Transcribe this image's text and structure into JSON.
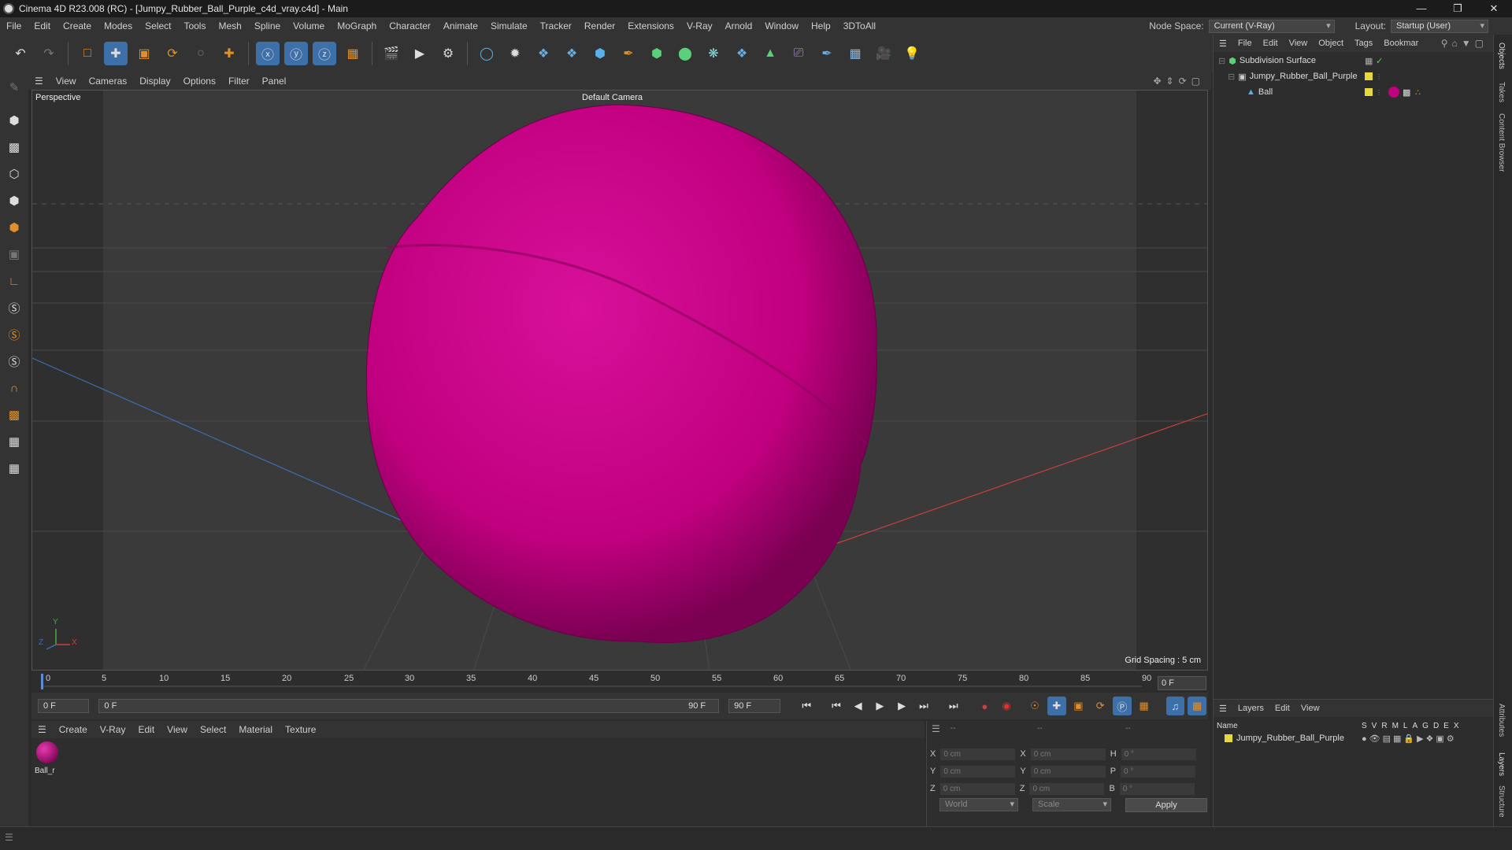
{
  "window": {
    "title": "Cinema 4D R23.008 (RC) - [Jumpy_Rubber_Ball_Purple_c4d_vray.c4d] - Main",
    "minimize": "—",
    "maximize": "❐",
    "close": "✕"
  },
  "menubar": {
    "items": [
      "File",
      "Edit",
      "Create",
      "Modes",
      "Select",
      "Tools",
      "Mesh",
      "Spline",
      "Volume",
      "MoGraph",
      "Character",
      "Animate",
      "Simulate",
      "Tracker",
      "Render",
      "Extensions",
      "V-Ray",
      "Arnold",
      "Window",
      "Help",
      "3DToAll"
    ],
    "node_space_label": "Node Space:",
    "node_space_value": "Current (V-Ray)",
    "layout_label": "Layout:",
    "layout_value": "Startup (User)"
  },
  "viewport": {
    "menu": [
      "View",
      "Cameras",
      "Display",
      "Options",
      "Filter",
      "Panel"
    ],
    "view_label": "Perspective",
    "camera_label": "Default Camera",
    "grid_spacing": "Grid Spacing : 5 cm",
    "axis_y": "Y",
    "axis_z": "Z",
    "axis_x": "X"
  },
  "colors": {
    "ball": "#c8008a",
    "accent": "#3d6fa8",
    "axis_red": "#c84040",
    "axis_blue": "#3c6fb0",
    "axis_green": "#4ca64c"
  },
  "timeline": {
    "ticks": [
      "0",
      "5",
      "10",
      "15",
      "20",
      "25",
      "30",
      "35",
      "40",
      "45",
      "50",
      "55",
      "60",
      "65",
      "70",
      "75",
      "80",
      "85",
      "90"
    ],
    "current_frame_field": "0 F",
    "start": "0 F",
    "range_start": "0 F",
    "range_end": "90 F",
    "end": "90 F"
  },
  "material_manager": {
    "menu": [
      "Create",
      "V-Ray",
      "Edit",
      "View",
      "Select",
      "Material",
      "Texture"
    ],
    "material_name": "Ball_r"
  },
  "coordinates": {
    "header_left": "--",
    "header_mid": "--",
    "header_right": "--",
    "rows": [
      {
        "a": "X",
        "av": "0 cm",
        "b": "X",
        "bv": "0 cm",
        "c": "H",
        "cv": "0 °"
      },
      {
        "a": "Y",
        "av": "0 cm",
        "b": "Y",
        "bv": "0 cm",
        "c": "P",
        "cv": "0 °"
      },
      {
        "a": "Z",
        "av": "0 cm",
        "b": "Z",
        "bv": "0 cm",
        "c": "B",
        "cv": "0 °"
      }
    ],
    "world": "World",
    "scale": "Scale",
    "apply": "Apply"
  },
  "object_manager": {
    "menu": [
      "File",
      "Edit",
      "View",
      "Object",
      "Tags",
      "Bookmar"
    ],
    "objects": [
      "Subdivision Surface",
      "Jumpy_Rubber_Ball_Purple",
      "Ball"
    ]
  },
  "layer_manager": {
    "menu": [
      "Layers",
      "Edit",
      "View"
    ],
    "name_col": "Name",
    "flags": [
      "S",
      "V",
      "R",
      "M",
      "L",
      "A",
      "G",
      "D",
      "E",
      "X"
    ],
    "layer": "Jumpy_Rubber_Ball_Purple"
  },
  "side_tabs": [
    "Objects",
    "Takes",
    "Content Browser",
    "Attributes",
    "Layers",
    "Structure"
  ]
}
